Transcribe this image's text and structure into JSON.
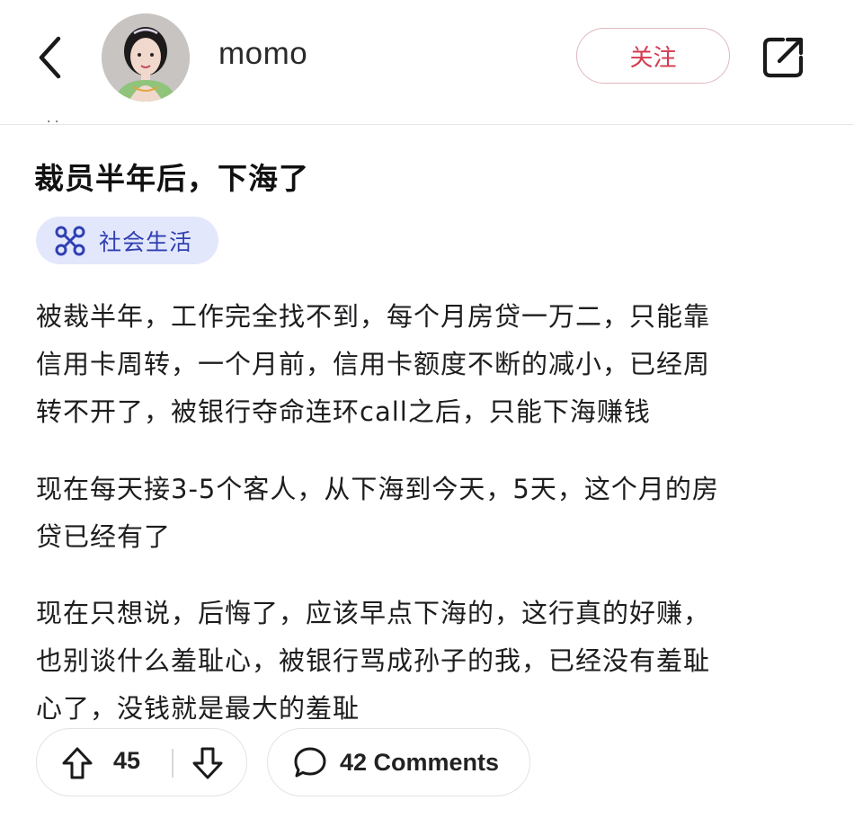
{
  "header": {
    "username": "momo",
    "follow_label": "关注"
  },
  "post": {
    "title": "裁员半年后，下海了",
    "tag": {
      "label": "社会生活",
      "icon": "community-icon",
      "color": "#2f3fb2",
      "background": "#e3e7fb"
    },
    "paragraphs": [
      [
        "被裁半年，工作完全找不到，每个月房贷一万二，只能靠",
        "信用卡周转，一个月前，信用卡额度不断的减小，已经周",
        "转不开了，被银行夺命连环call之后，只能下海赚钱"
      ],
      [
        "现在每天接3-5个客人，从下海到今天，5天，这个月的房",
        "贷已经有了"
      ],
      [
        "现在只想说，后悔了，应该早点下海的，这行真的好赚，",
        "也别谈什么羞耻心，被银行骂成孙子的我，已经没有羞耻",
        "心了，没钱就是最大的羞耻"
      ]
    ]
  },
  "actions": {
    "votes": "45",
    "comments_label": "42 Comments"
  },
  "colors": {
    "follow_text": "#d43a50",
    "follow_border": "#e0b7bd"
  }
}
